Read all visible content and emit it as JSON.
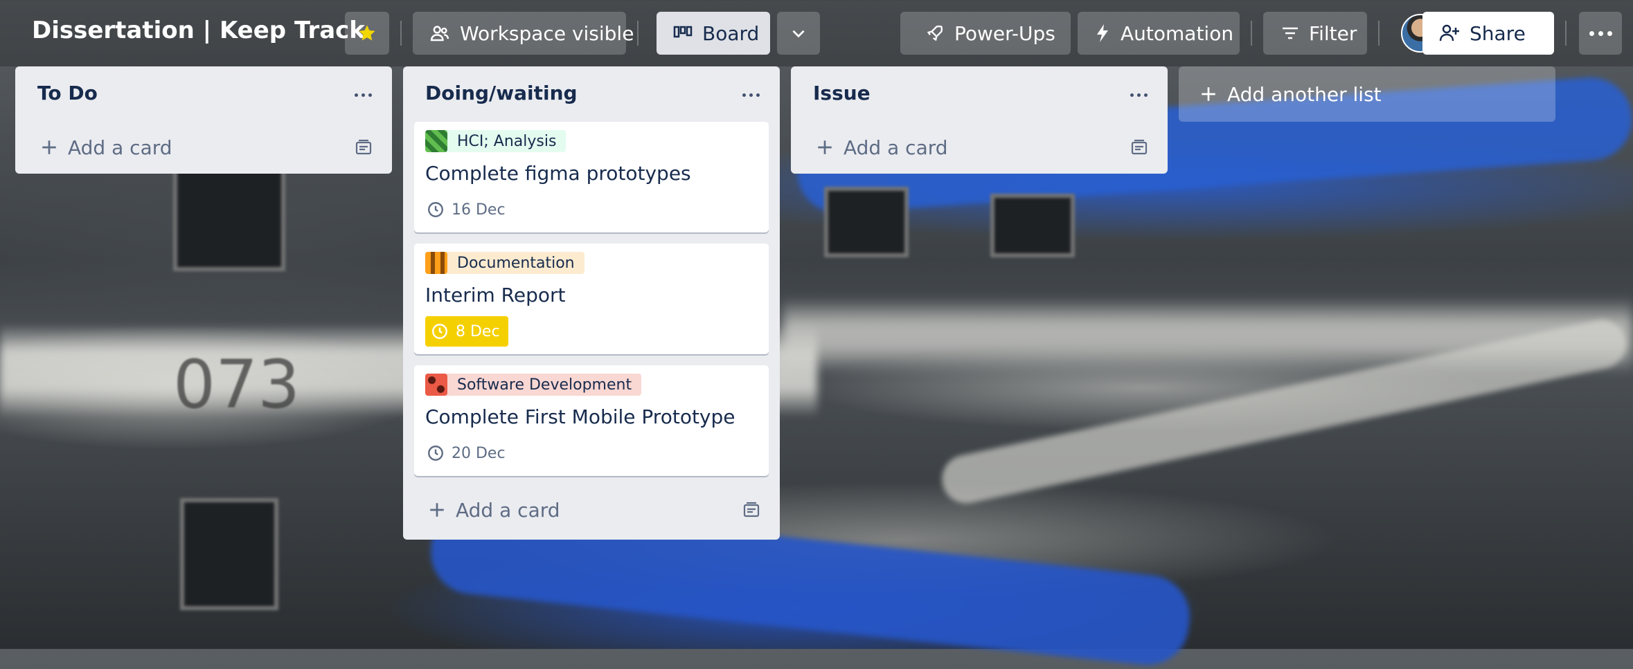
{
  "header": {
    "board_title": "Dissertation | Keep Track",
    "visibility_label": "Workspace visible",
    "view_label": "Board",
    "powerups_label": "Power-Ups",
    "automation_label": "Automation",
    "filter_label": "Filter",
    "share_label": "Share"
  },
  "lists": [
    {
      "title": "To Do",
      "add_card_label": "Add a card",
      "cards": []
    },
    {
      "title": "Doing/waiting",
      "add_card_label": "Add a card",
      "cards": [
        {
          "label": "HCI; Analysis",
          "label_color": "#e3fcef",
          "swatch_color": "#61bd4f",
          "title": "Complete figma prototypes",
          "due": "16 Dec",
          "due_state": "normal"
        },
        {
          "label": "Documentation",
          "label_color": "#fdebd0",
          "swatch_color": "#ff9f1a",
          "title": "Interim Report",
          "due": "8 Dec",
          "due_state": "due-soon"
        },
        {
          "label": "Software Development",
          "label_color": "#f9d7d3",
          "swatch_color": "#eb5a46",
          "title": "Complete First Mobile Prototype",
          "due": "20 Dec",
          "due_state": "normal"
        }
      ]
    },
    {
      "title": "Issue",
      "add_card_label": "Add a card",
      "cards": []
    }
  ],
  "add_list_label": "Add another list",
  "background_text": "073",
  "colors": {
    "star": "#f2d600",
    "due_soon": "#f5d000",
    "list_bg": "#ebecf0",
    "text_dark": "#172b4d"
  },
  "icons": [
    "star-icon",
    "workspace-icon",
    "board-icon",
    "chevron-down-icon",
    "rocket-icon",
    "lightning-icon",
    "filter-icon",
    "add-person-icon",
    "more-icon",
    "plus-icon",
    "template-icon",
    "clock-icon"
  ]
}
